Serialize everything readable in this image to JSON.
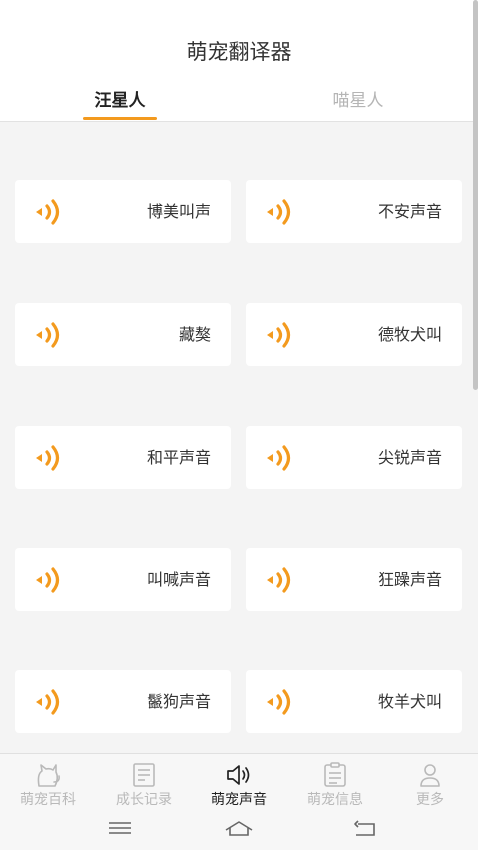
{
  "header": {
    "title": "萌宠翻译器"
  },
  "tabs": [
    {
      "label": "汪星人",
      "active": true
    },
    {
      "label": "喵星人",
      "active": false
    }
  ],
  "accent_color": "#f39a1e",
  "sounds": [
    {
      "label": "博美叫声",
      "icon": "speaker-icon"
    },
    {
      "label": "不安声音",
      "icon": "speaker-icon"
    },
    {
      "label": "藏獒",
      "icon": "speaker-icon"
    },
    {
      "label": "德牧犬叫",
      "icon": "speaker-icon"
    },
    {
      "label": "和平声音",
      "icon": "speaker-icon"
    },
    {
      "label": "尖锐声音",
      "icon": "speaker-icon"
    },
    {
      "label": "叫喊声音",
      "icon": "speaker-icon"
    },
    {
      "label": "狂躁声音",
      "icon": "speaker-icon"
    },
    {
      "label": "鬣狗声音",
      "icon": "speaker-icon"
    },
    {
      "label": "牧羊犬叫",
      "icon": "speaker-icon"
    }
  ],
  "bottom_nav": [
    {
      "label": "萌宠百科",
      "icon": "cat-icon",
      "active": false
    },
    {
      "label": "成长记录",
      "icon": "notebook-icon",
      "active": false
    },
    {
      "label": "萌宠声音",
      "icon": "sound-icon",
      "active": true
    },
    {
      "label": "萌宠信息",
      "icon": "clipboard-icon",
      "active": false
    },
    {
      "label": "更多",
      "icon": "person-icon",
      "active": false
    }
  ],
  "system_nav": [
    "menu-icon",
    "home-icon",
    "back-icon"
  ]
}
